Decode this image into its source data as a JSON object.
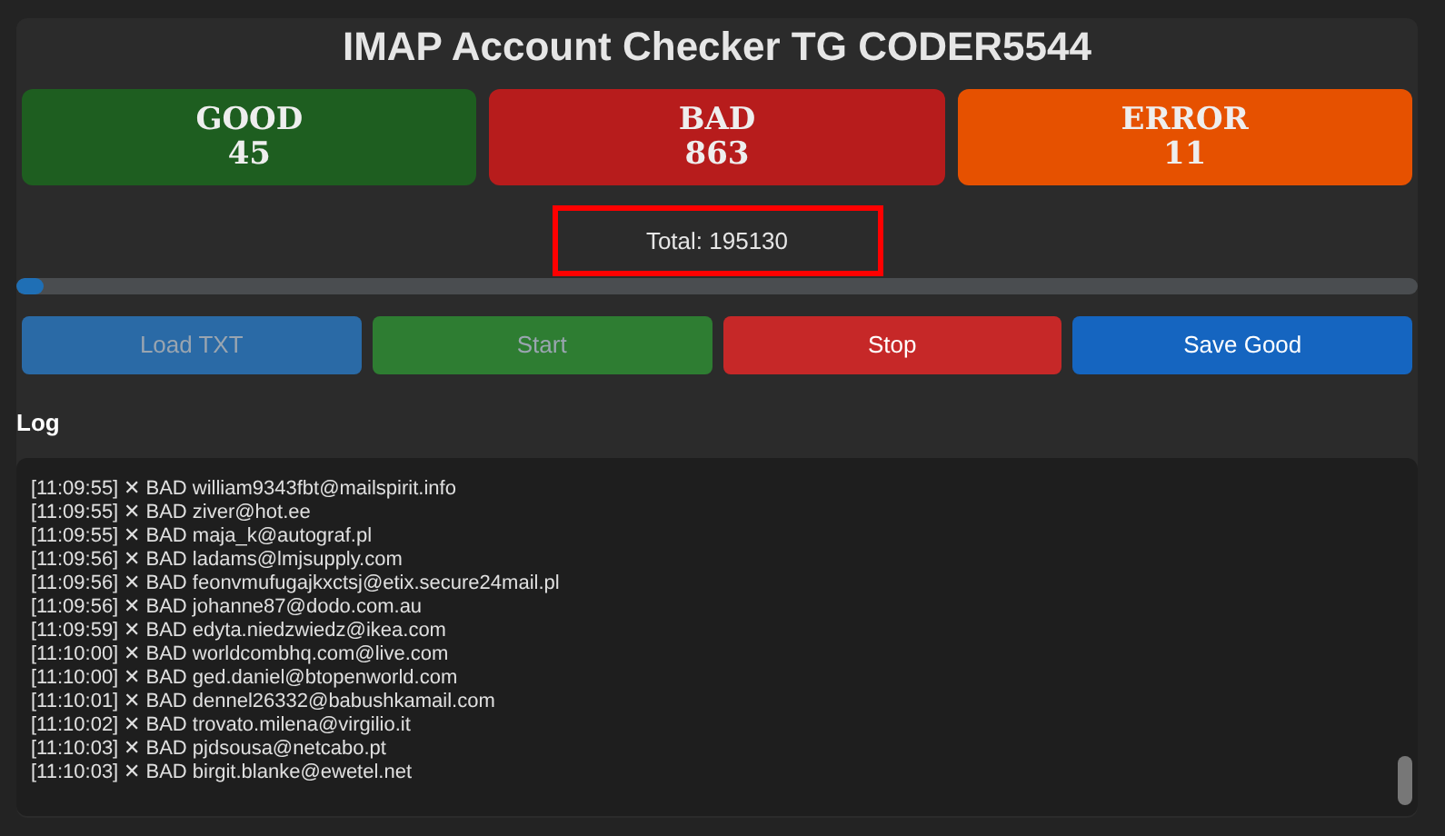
{
  "title": "IMAP Account Checker TG CODER5544",
  "stats": [
    {
      "label": "GOOD",
      "value": "45",
      "color": "#1e5e20"
    },
    {
      "label": "BAD",
      "value": "863",
      "color": "#b71c1c"
    },
    {
      "label": "ERROR",
      "value": "11",
      "color": "#e65100"
    }
  ],
  "total": "Total: 195130",
  "progress": {
    "level": 0.02
  },
  "buttons": [
    {
      "label": "Load TXT",
      "disabled": true,
      "color": "#2a6aa6"
    },
    {
      "label": "Start",
      "disabled": true,
      "color": "#2e7d32"
    },
    {
      "label": "Stop",
      "disabled": false,
      "color": "#c62828"
    },
    {
      "label": "Save Good",
      "disabled": false,
      "color": "#1565c0"
    }
  ],
  "log": {
    "title": "Log",
    "lines": [
      "[11:09:55] ✕ BAD william9343fbt@mailspirit.info",
      "[11:09:55] ✕ BAD ziver@hot.ee",
      "[11:09:55] ✕ BAD maja_k@autograf.pl",
      "[11:09:56] ✕ BAD ladams@lmjsupply.com",
      "[11:09:56] ✕ BAD feonvmufugajkxctsj@etix.secure24mail.pl",
      "[11:09:56] ✕ BAD johanne87@dodo.com.au",
      "[11:09:59] ✕ BAD edyta.niedzwiedz@ikea.com",
      "[11:10:00] ✕ BAD worldcombhq.com@live.com",
      "[11:10:00] ✕ BAD ged.daniel@btopenworld.com",
      "[11:10:01] ✕ BAD dennel26332@babushkamail.com",
      "[11:10:02] ✕ BAD trovato.milena@virgilio.it",
      "[11:10:03] ✕ BAD pjdsousa@netcabo.pt",
      "[11:10:03] ✕ BAD birgit.blanke@ewetel.net"
    ]
  }
}
